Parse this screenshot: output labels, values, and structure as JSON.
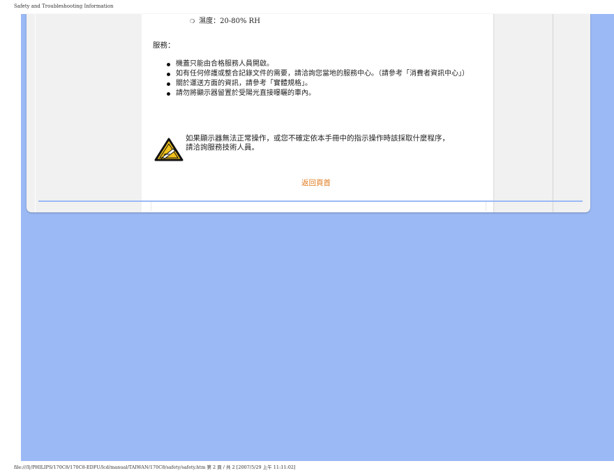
{
  "page_header": "Safety and Troubleshooting Information",
  "humidity": {
    "bullet": "❍",
    "text": "濕度：20-80% RH"
  },
  "service": {
    "heading": "服務：",
    "items": [
      "機蓋只能由合格服務人員開啟。",
      "如有任何修護或整合記錄文件的需要，請洽詢您當地的服務中心。（請參考「消費者資訊中心」）",
      "關於運送方面的資訊，請參考「實體規格」。",
      "請勿將顯示器留置於受陽光直接曝曬的車內。"
    ]
  },
  "warning": {
    "icon": "warning-triangle-icon",
    "text": "如果顯示器無法正常操作，或您不確定依本手冊中的指示操作時該採取什麼程序，請洽詢服務技術人員。"
  },
  "back_link": "返回頁首",
  "footer": "file:///I|/PHILIPS/170C8/170C8-EDFU/lcd/manual/TAIWAN/170C8/safety/safety.htm 第 2 頁 / 共 2 [2007/5/29 上午 11:11:02]",
  "colors": {
    "page_background": "#9bb9f5",
    "link": "#e07a1f",
    "warning_yellow": "#f2c21b"
  }
}
